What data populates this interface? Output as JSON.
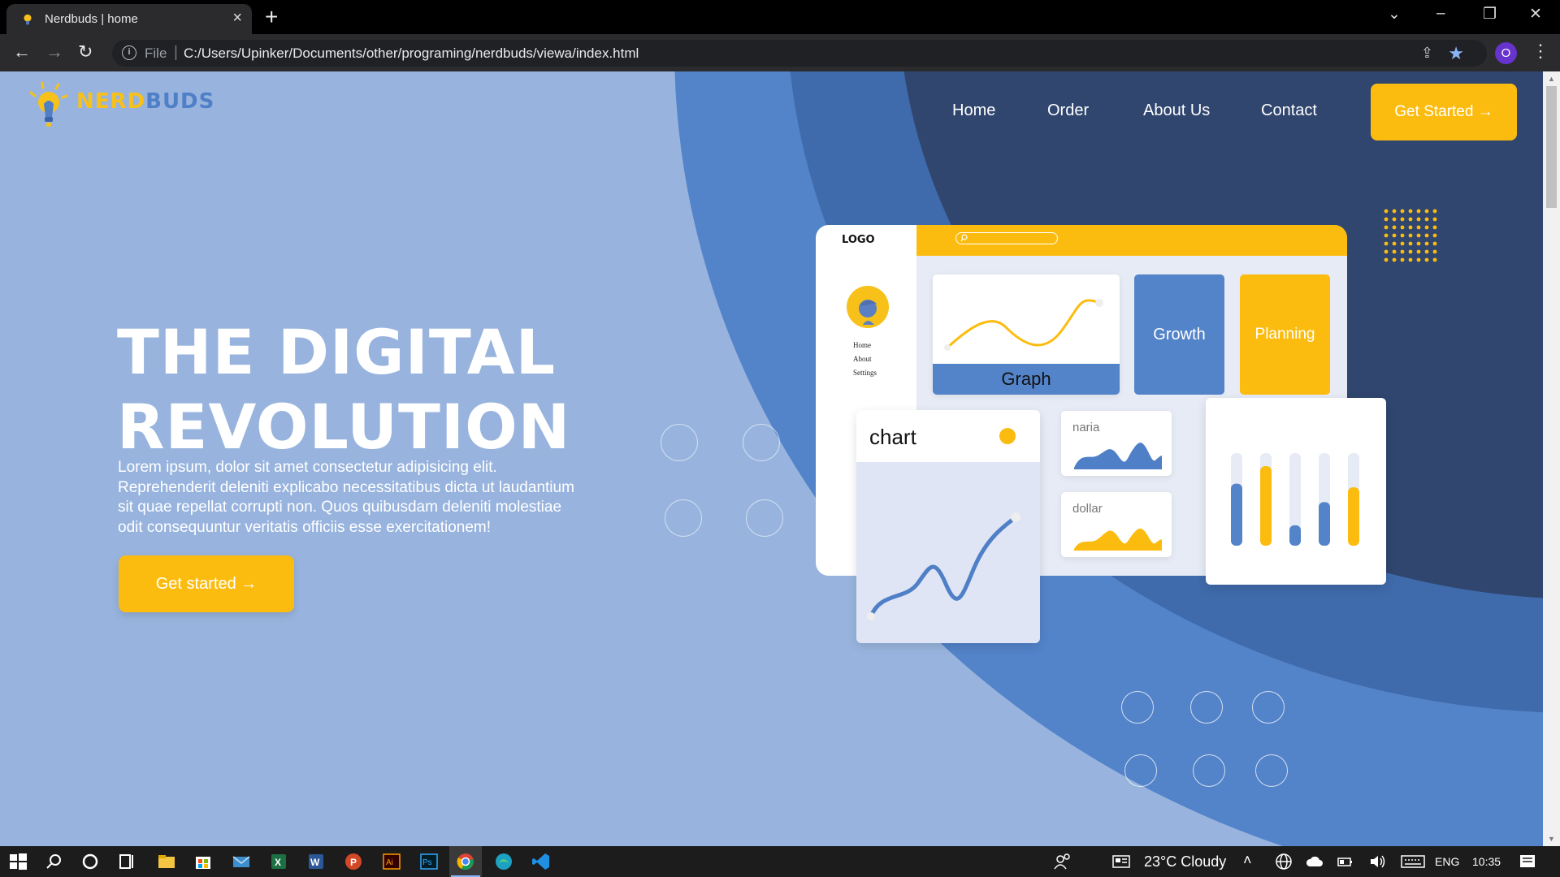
{
  "browser": {
    "tab_title": "Nerdbuds | home",
    "tab_close": "×",
    "new_tab": "+",
    "url_scheme": "File",
    "url": "C:/Users/Upinker/Documents/other/programing/nerdbuds/viewa/index.html",
    "profile_initial": "O",
    "controls": {
      "minimize": "–",
      "restore": "❐",
      "close": "✕",
      "tab_search": "⌄"
    }
  },
  "site": {
    "logo_part1": "NERD",
    "logo_part2": "BUDS",
    "nav": [
      "Home",
      "Order",
      "About Us",
      "Contact"
    ],
    "cta_top": "Get Started →",
    "hero_title_line1": "THE DIGITAL",
    "hero_title_line2": "REVOLUTION",
    "hero_body": "Lorem ipsum, dolor sit amet consectetur adipisicing elit. Reprehenderit deleniti explicabo necessitatibus dicta ut laudantium sit quae repellat corrupti non. Quos quibusdam deleniti molestiae odit consequuntur veritatis officiis esse exercitationem!",
    "cta_hero": "Get started →"
  },
  "illustration": {
    "logo": "LOGO",
    "menu": [
      "Home",
      "About",
      "Settings"
    ],
    "graph_label": "Graph",
    "growth_label": "Growth",
    "planning_label": "Planning",
    "chart_label": "chart",
    "mini1_label": "naria",
    "mini2_label": "dollar",
    "bar_levels": [
      0.67,
      0.86,
      0.22,
      0.47,
      0.63
    ],
    "bar_colors": [
      "#5383c9",
      "#fcbc0f",
      "#5383c9",
      "#5383c9",
      "#fcbc0f"
    ]
  },
  "taskbar": {
    "weather": "23°C  Cloudy",
    "language": "ENG",
    "time": "10:35"
  },
  "colors": {
    "accent_yellow": "#fcbc0f",
    "accent_blue": "#5383c9",
    "hero_bg": "#98b4de",
    "dark_navy": "#30466e"
  }
}
